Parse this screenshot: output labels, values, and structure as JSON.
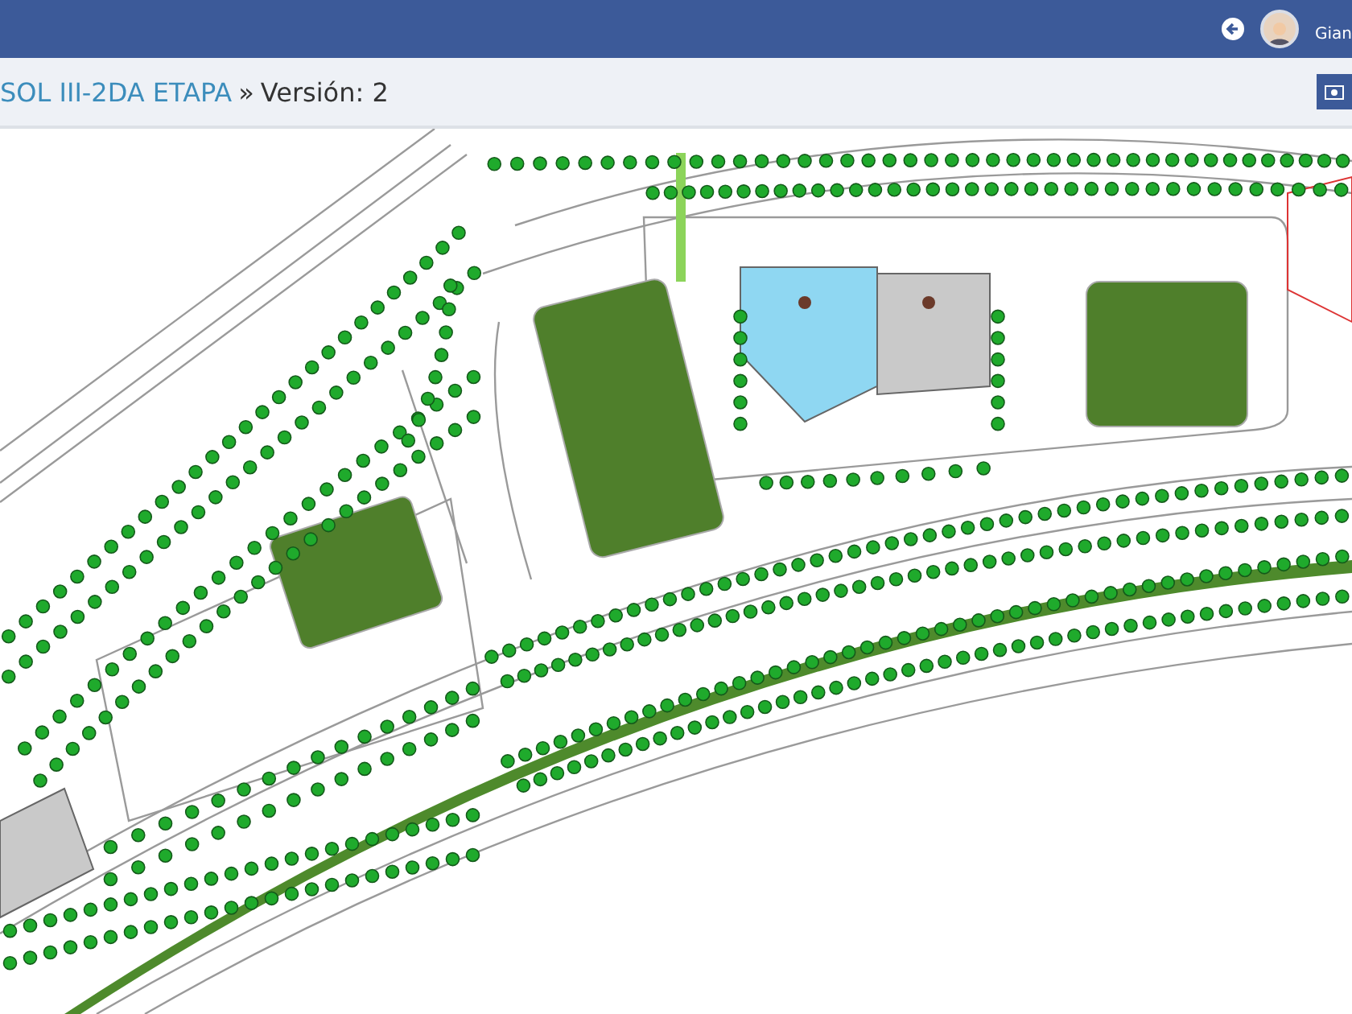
{
  "top_bar": {
    "user_name": "Gian"
  },
  "breadcrumb": {
    "project": "SOL III-2DA ETAPA",
    "separator": "»",
    "version": "Versión: 2"
  }
}
